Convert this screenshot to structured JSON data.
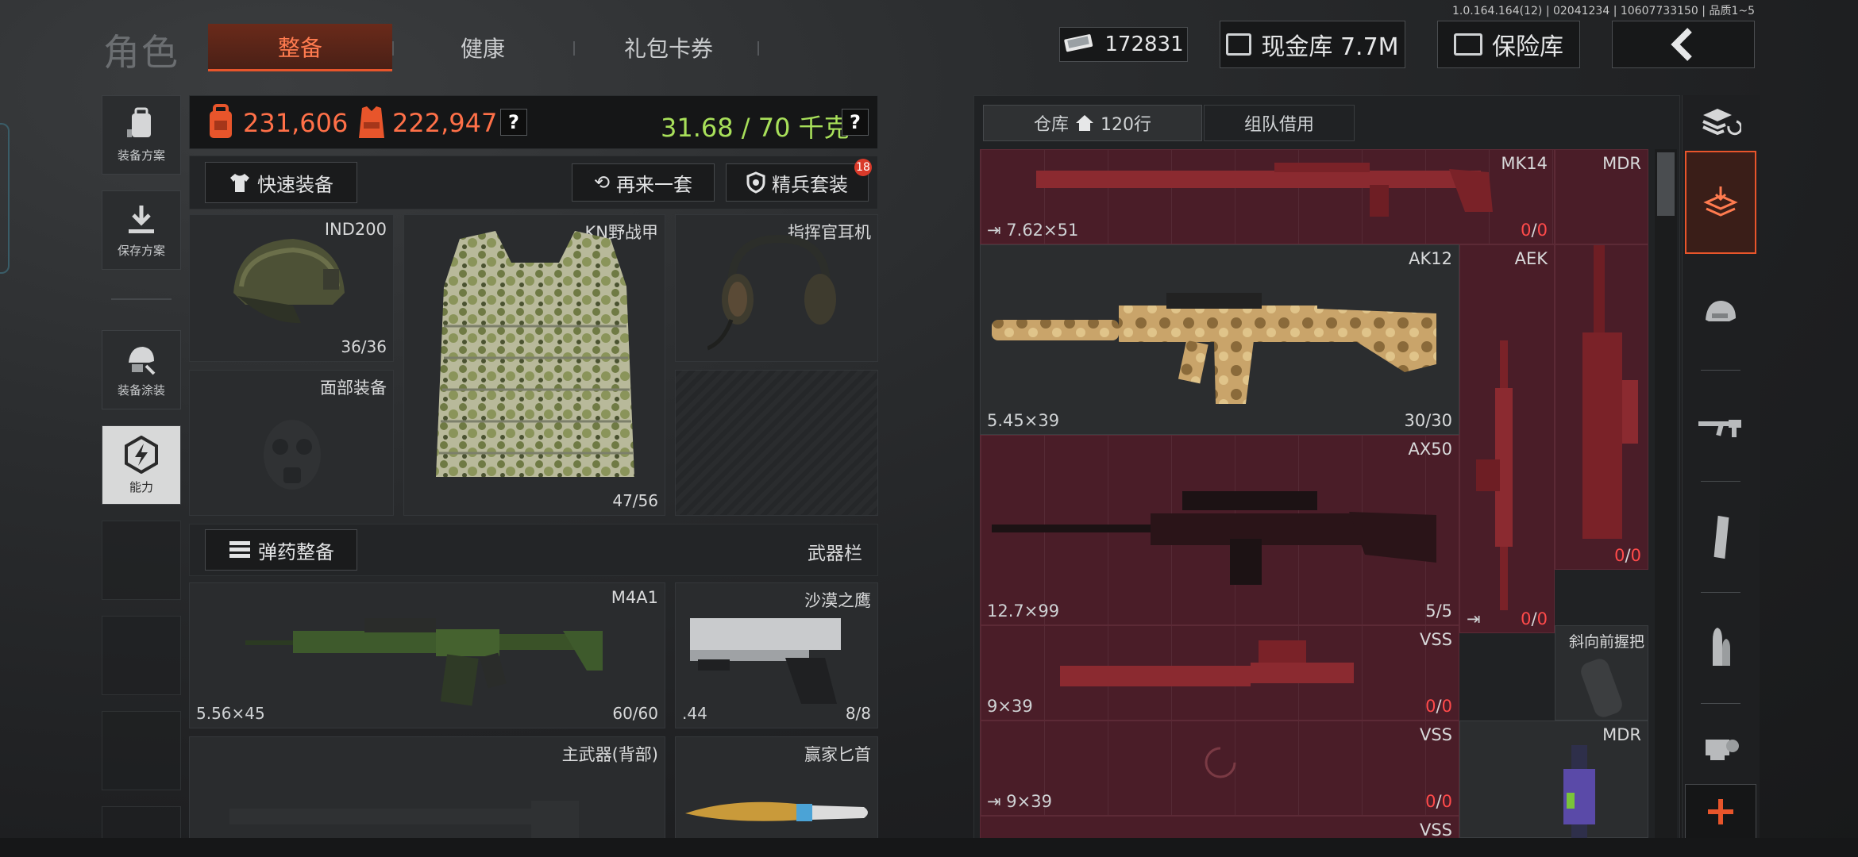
{
  "version": "1.0.164.164(12) | 02041234 | 10607733150 | 品质1~5",
  "header": {
    "title": "角色",
    "tabs": [
      {
        "label": "整备",
        "active": true
      },
      {
        "label": "健康",
        "active": false
      },
      {
        "label": "礼包卡券",
        "active": false
      }
    ],
    "money": "172831",
    "cash_vault": "现金库 7.7M",
    "safe": "保险库"
  },
  "left_menu": [
    {
      "label": "装备方案",
      "icon": "backpack-icon"
    },
    {
      "label": "保存方案",
      "icon": "download-icon"
    },
    {
      "label": "装备涂装",
      "icon": "helmet-paint-icon"
    },
    {
      "label": "能力",
      "icon": "ability-icon"
    }
  ],
  "loadout": {
    "backpack_value": "231,606",
    "vest_value": "222,947",
    "weight": "31.68 / 70 千克",
    "quick_equip": "快速装备",
    "again": "再来一套",
    "elite": "精兵套装",
    "elite_badge": "18",
    "helmet": {
      "name": "IND200",
      "count": "36/36"
    },
    "armor": {
      "name": "KN野战甲",
      "count": "47/56"
    },
    "headset": {
      "name": "指挥官耳机"
    },
    "face": {
      "name": "面部装备"
    },
    "ammo_button": "弹药整备",
    "weapon_bar": "武器栏",
    "primary": {
      "name": "M4A1",
      "caliber": "5.56×45",
      "count": "60/60"
    },
    "pistol": {
      "name": "沙漠之鹰",
      "caliber": ".44",
      "count": "8/8"
    },
    "back_weapon": {
      "name": "主武器(背部)"
    },
    "knife": {
      "name": "赢家匕首"
    }
  },
  "warehouse": {
    "tab_storage": "仓库",
    "rows": "120行",
    "tab_team": "组队借用",
    "items": [
      {
        "name": "MK14",
        "caliber": "7.62×51",
        "count_a": "0",
        "count_b": "0"
      },
      {
        "name": "MDR"
      },
      {
        "name": "AK12",
        "caliber": "5.45×39",
        "count": "30/30"
      },
      {
        "name": "AEK"
      },
      {
        "name": "AX50",
        "caliber": "12.7×99",
        "count": "5/5"
      },
      {
        "name": "",
        "count_a": "0",
        "count_b": "0"
      },
      {
        "name": "VSS",
        "caliber": "9×39",
        "count_a": "0",
        "count_b": "0"
      },
      {
        "name": "",
        "count_a": "0",
        "count_b": "0"
      },
      {
        "name": "斜向前握把"
      },
      {
        "name": "VSS",
        "caliber": "9×39",
        "count_a": "0",
        "count_b": "0"
      },
      {
        "name": "MDR"
      },
      {
        "name": "VSS"
      }
    ]
  },
  "colors": {
    "accent": "#e8552b",
    "weight_green": "#a8e05a",
    "warn_red": "#ff4a4a",
    "item_bg": "#4a1d28"
  }
}
